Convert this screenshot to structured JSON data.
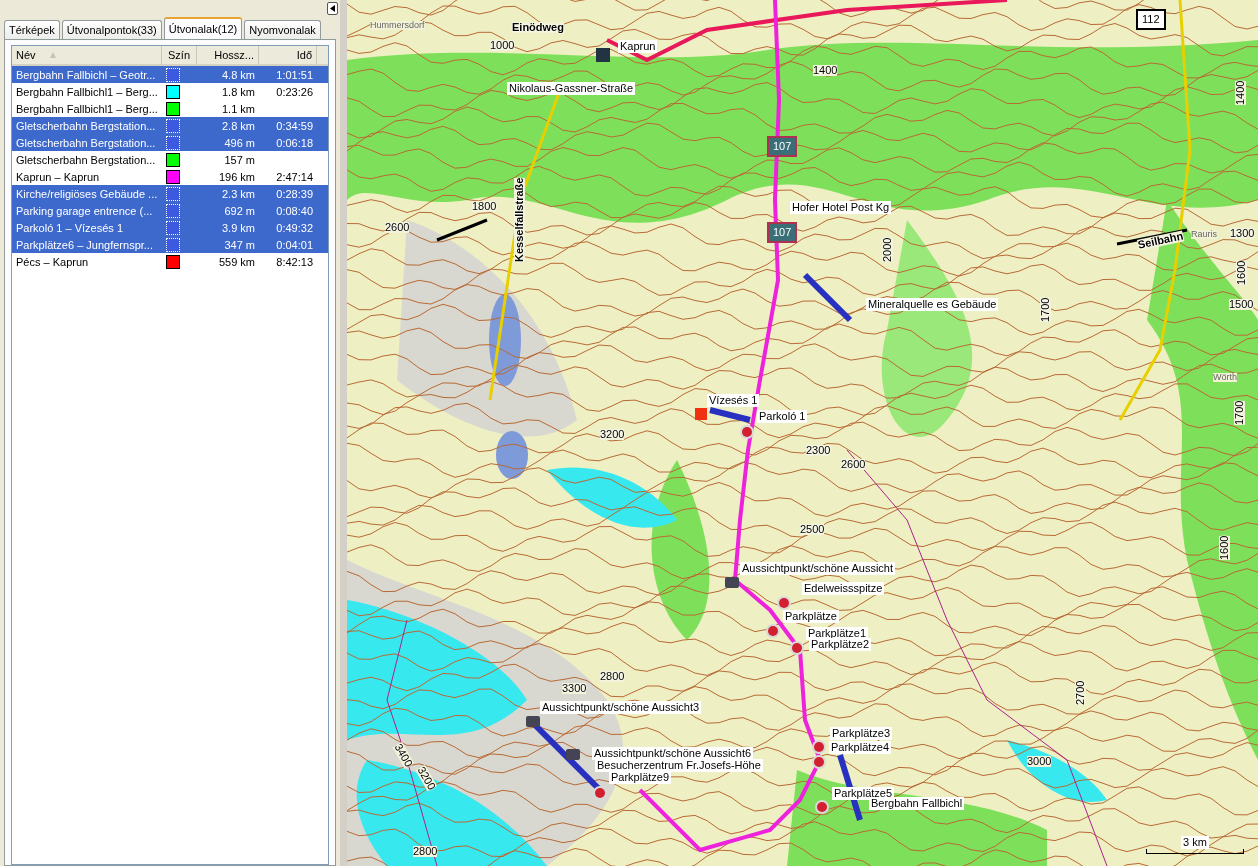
{
  "tabs": [
    {
      "label": "Térképek",
      "selected": false
    },
    {
      "label": "Útvonalpontok(33)",
      "selected": false
    },
    {
      "label": "Útvonalak(12)",
      "selected": true
    },
    {
      "label": "Nyomvonalak",
      "selected": false
    }
  ],
  "table": {
    "columns": [
      "Név",
      "Szín",
      "Hossz...",
      "Idő"
    ],
    "rows": [
      {
        "name": "Bergbahn Fallbichl – Geotr...",
        "color": "#3c5ae0",
        "length": "4.8 km",
        "time": "1:01:51",
        "selected": true
      },
      {
        "name": "Bergbahn Fallbichl1 – Berg...",
        "color": "#00ffff",
        "length": "1.8 km",
        "time": "0:23:26",
        "selected": false
      },
      {
        "name": "Bergbahn Fallbichl1 – Berg...",
        "color": "#00ff00",
        "length": "1.1 km",
        "selected": false
      },
      {
        "name": "Gletscherbahn Bergstation...",
        "color": "#3c5ae0",
        "length": "2.8 km",
        "time": "0:34:59",
        "selected": true
      },
      {
        "name": "Gletscherbahn Bergstation...",
        "color": "#3c5ae0",
        "length": "496 m",
        "time": "0:06:18",
        "selected": true
      },
      {
        "name": "Gletscherbahn Bergstation...",
        "color": "#00ff00",
        "length": "157 m",
        "selected": false
      },
      {
        "name": "Kaprun – Kaprun",
        "color": "#ff00ff",
        "length": "196 km",
        "time": "2:47:14",
        "selected": false
      },
      {
        "name": "Kirche/religiöses Gebäude ...",
        "color": "#3c5ae0",
        "length": "2.3 km",
        "time": "0:28:39",
        "selected": true
      },
      {
        "name": "Parking garage entrence (...",
        "color": "#3c5ae0",
        "length": "692 m",
        "time": "0:08:40",
        "selected": true
      },
      {
        "name": "Parkoló 1 – Vízesés 1",
        "color": "#3c5ae0",
        "length": "3.9 km",
        "time": "0:49:32",
        "selected": true
      },
      {
        "name": "Parkplätze6 – Jungfernspr...",
        "color": "#3c5ae0",
        "length": "347 m",
        "time": "0:04:01",
        "selected": true
      },
      {
        "name": "Pécs – Kaprun",
        "color": "#ff0000",
        "length": "559 km",
        "time": "8:42:13",
        "selected": false
      }
    ]
  },
  "map": {
    "labels": [
      {
        "text": "Kaprun",
        "kind": "waypoint"
      },
      {
        "text": "Nikolaus-Gassner-Straße",
        "kind": "waypoint"
      },
      {
        "text": "Hofer Hotel Post Kg",
        "kind": "waypoint"
      },
      {
        "text": "Mineralquelle es Gebäude",
        "kind": "waypoint"
      },
      {
        "text": "Vízesés 1",
        "kind": "waypoint"
      },
      {
        "text": "Parkoló 1",
        "kind": "waypoint"
      },
      {
        "text": "Aussichtpunkt/schöne Aussicht",
        "kind": "waypoint"
      },
      {
        "text": "Edelweissspitze",
        "kind": "waypoint"
      },
      {
        "text": "Parkplätze",
        "kind": "waypoint"
      },
      {
        "text": "Parkplätze1",
        "kind": "waypoint"
      },
      {
        "text": "Parkplätze2",
        "kind": "waypoint"
      },
      {
        "text": "Aussichtpunkt/schöne Aussicht3",
        "kind": "waypoint"
      },
      {
        "text": "Aussichtpunkt/schöne Aussicht6",
        "kind": "waypoint"
      },
      {
        "text": "Besucherzentrum Fr.Josefs-Höhe",
        "kind": "waypoint"
      },
      {
        "text": "Parkplätze9",
        "kind": "waypoint"
      },
      {
        "text": "Parkplätze3",
        "kind": "waypoint"
      },
      {
        "text": "Parkplätze4",
        "kind": "waypoint"
      },
      {
        "text": "Parkplätze5",
        "kind": "waypoint"
      },
      {
        "text": "Bergbahn Fallbichl",
        "kind": "waypoint"
      },
      {
        "text": "Einödweg",
        "kind": "road"
      },
      {
        "text": "Kesselfallstraße",
        "kind": "road"
      },
      {
        "text": "Seilbahn",
        "kind": "road"
      },
      {
        "text": "Hummersdorf",
        "kind": "place"
      },
      {
        "text": "Rauris",
        "kind": "place"
      },
      {
        "text": "Wörth",
        "kind": "place"
      },
      {
        "text": "112",
        "kind": "shield"
      },
      {
        "text": "107",
        "kind": "route-shield"
      },
      {
        "text": "107",
        "kind": "route-shield"
      },
      {
        "text": "1000",
        "kind": "elevation"
      },
      {
        "text": "1400",
        "kind": "elevation"
      },
      {
        "text": "1800",
        "kind": "elevation"
      },
      {
        "text": "2600",
        "kind": "elevation"
      },
      {
        "text": "3200",
        "kind": "elevation"
      },
      {
        "text": "2300",
        "kind": "elevation"
      },
      {
        "text": "2600",
        "kind": "elevation"
      },
      {
        "text": "2500",
        "kind": "elevation"
      },
      {
        "text": "2800",
        "kind": "elevation"
      },
      {
        "text": "3300",
        "kind": "elevation"
      },
      {
        "text": "2800",
        "kind": "elevation"
      },
      {
        "text": "3000",
        "kind": "elevation"
      },
      {
        "text": "1300",
        "kind": "elevation"
      },
      {
        "text": "1500",
        "kind": "elevation"
      },
      {
        "text": "1400",
        "kind": "elevation"
      },
      {
        "text": "1600",
        "kind": "elevation"
      },
      {
        "text": "1700",
        "kind": "elevation"
      },
      {
        "text": "2000",
        "kind": "elevation"
      },
      {
        "text": "1700",
        "kind": "elevation"
      },
      {
        "text": "1600",
        "kind": "elevation"
      },
      {
        "text": "2700",
        "kind": "elevation"
      },
      {
        "text": "3400",
        "kind": "elevation"
      },
      {
        "text": "3200",
        "kind": "elevation"
      }
    ],
    "scale": "3 km"
  }
}
